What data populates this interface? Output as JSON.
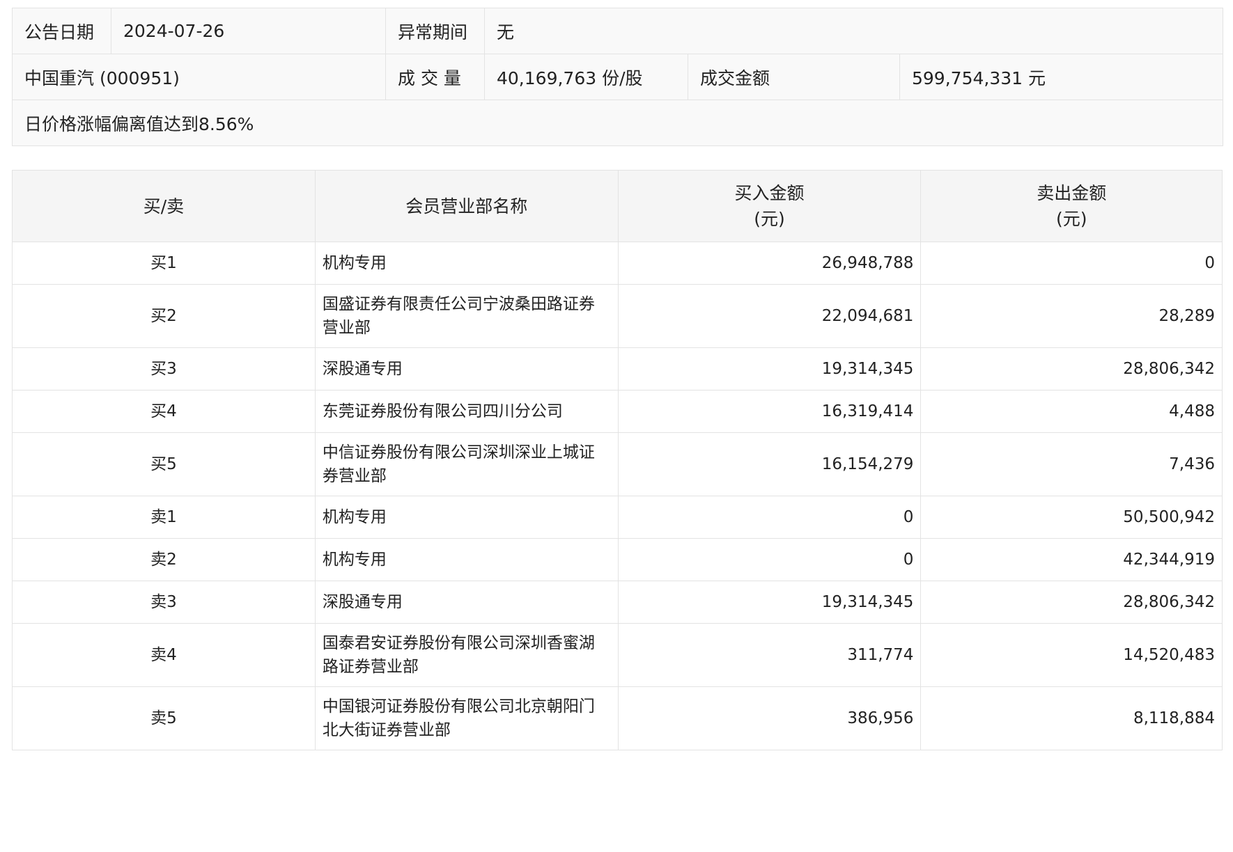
{
  "info": {
    "date_label": "公告日期",
    "date_value": "2024-07-26",
    "abnormal_label": "异常期间",
    "abnormal_value": "无",
    "stock": "中国重汽 (000951)",
    "volume_label": "成 交 量",
    "volume_value": "40,169,763 份/股",
    "amount_label": "成交金额",
    "amount_value": "599,754,331 元",
    "reason": "日价格涨幅偏离值达到8.56%"
  },
  "table": {
    "headers": {
      "side": "买/卖",
      "name": "会员营业部名称",
      "buy_line1": "买入金额",
      "buy_line2": "(元)",
      "sell_line1": "卖出金额",
      "sell_line2": "(元)"
    },
    "rows": [
      {
        "side": "买1",
        "name": "机构专用",
        "buy": "26,948,788",
        "sell": "0"
      },
      {
        "side": "买2",
        "name": "国盛证券有限责任公司宁波桑田路证券营业部",
        "buy": "22,094,681",
        "sell": "28,289"
      },
      {
        "side": "买3",
        "name": "深股通专用",
        "buy": "19,314,345",
        "sell": "28,806,342"
      },
      {
        "side": "买4",
        "name": "东莞证券股份有限公司四川分公司",
        "buy": "16,319,414",
        "sell": "4,488"
      },
      {
        "side": "买5",
        "name": "中信证券股份有限公司深圳深业上城证券营业部",
        "buy": "16,154,279",
        "sell": "7,436"
      },
      {
        "side": "卖1",
        "name": "机构专用",
        "buy": "0",
        "sell": "50,500,942"
      },
      {
        "side": "卖2",
        "name": "机构专用",
        "buy": "0",
        "sell": "42,344,919"
      },
      {
        "side": "卖3",
        "name": "深股通专用",
        "buy": "19,314,345",
        "sell": "28,806,342"
      },
      {
        "side": "卖4",
        "name": "国泰君安证券股份有限公司深圳香蜜湖路证券营业部",
        "buy": "311,774",
        "sell": "14,520,483"
      },
      {
        "side": "卖5",
        "name": "中国银河证券股份有限公司北京朝阳门北大街证券营业部",
        "buy": "386,956",
        "sell": "8,118,884"
      }
    ]
  }
}
